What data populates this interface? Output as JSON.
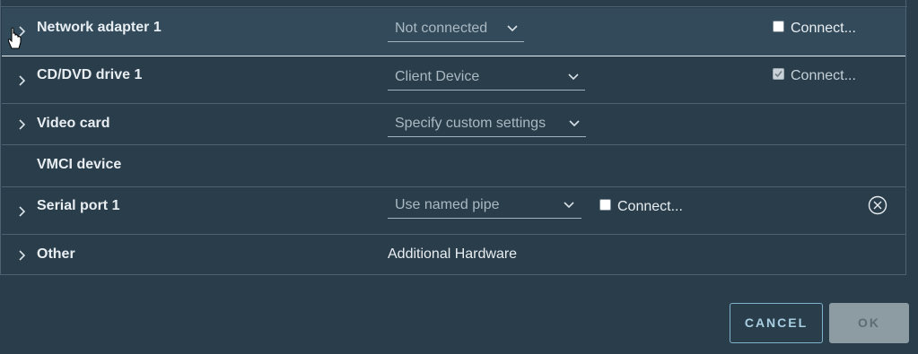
{
  "rows": [
    {
      "label": "Network adapter 1",
      "select_value": "Not connected",
      "connect_label": "Connect...",
      "connect_checked": false
    },
    {
      "label": "CD/DVD drive 1",
      "select_value": "Client Device",
      "connect_label": "Connect...",
      "connect_checked": true
    },
    {
      "label": "Video card",
      "select_value": "Specify custom settings"
    },
    {
      "label": "VMCI device"
    },
    {
      "label": "Serial port 1",
      "select_value": "Use named pipe",
      "connect_label": "Connect...",
      "connect_checked": false
    },
    {
      "label": "Other",
      "value_text": "Additional Hardware"
    }
  ],
  "footer": {
    "cancel_label": "CANCEL",
    "ok_label": "OK"
  },
  "colors": {
    "background": "#2a3d4a",
    "highlight_row": "#324a5a",
    "accent": "#7fb1cc"
  },
  "icons": {
    "expand": "chevron-right-icon",
    "dropdown": "chevron-down-icon",
    "remove": "remove-circle-icon",
    "cursor": "hand-pointer-icon"
  }
}
